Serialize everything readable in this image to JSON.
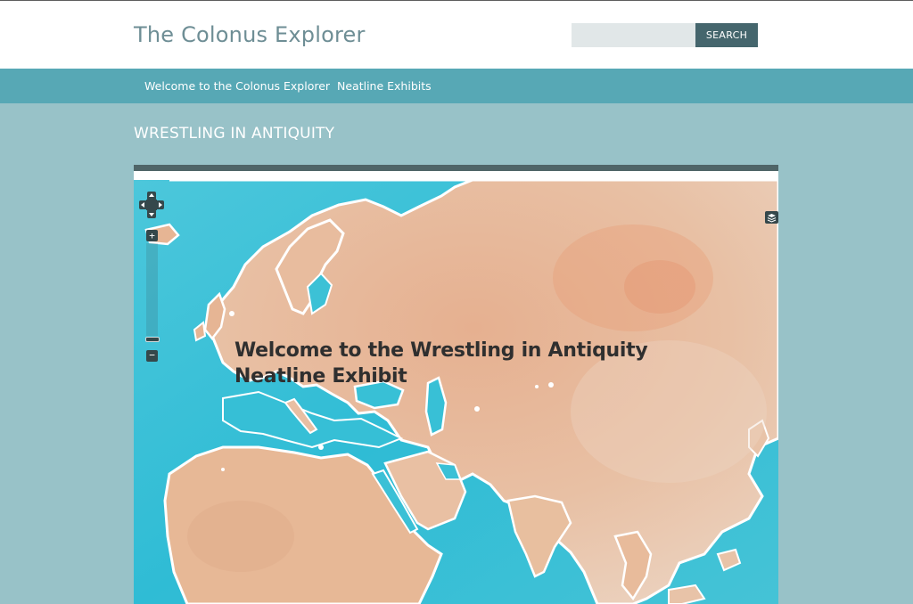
{
  "header": {
    "site_title": "The Colonus Explorer",
    "search": {
      "value": "",
      "placeholder": "",
      "button_label": "SEARCH"
    }
  },
  "nav": {
    "items": [
      {
        "label": "Welcome to the Colonus Explorer"
      },
      {
        "label": "Neatline Exhibits"
      }
    ]
  },
  "page": {
    "title": "WRESTLING IN ANTIQUITY"
  },
  "map": {
    "overlay_text": "Welcome to the Wrestling in Antiquity Neatline Exhibit",
    "controls": {
      "pan_icon": "pan-arrows-icon",
      "zoom_in_label": "+",
      "zoom_out_label": "−",
      "layer_switcher_icon": "layers-icon"
    }
  },
  "colors": {
    "header_bg": "#ffffff",
    "nav_bg": "#57a8b5",
    "page_bg": "#98c2c8",
    "search_button_bg": "#45666d",
    "water": "#3ec3d8",
    "land": "#e7b08f"
  }
}
